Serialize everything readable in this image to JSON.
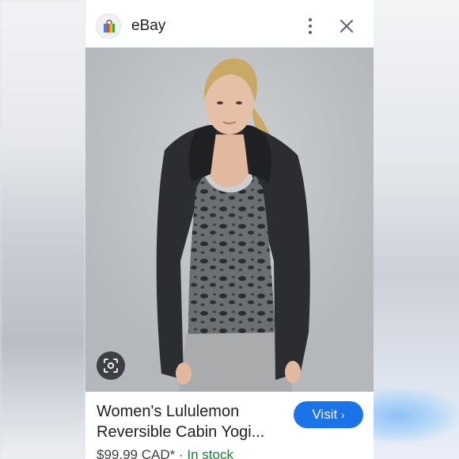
{
  "header": {
    "app_name": "eBay",
    "app_icon": "shopping-bag-icon",
    "more_icon": "more-vert-icon",
    "close_icon": "close-icon"
  },
  "image": {
    "alt": "Woman wearing dark cardigan over leopard print tank top",
    "lens_icon": "lens-search-icon"
  },
  "product": {
    "title_line1": "Women's Lululemon",
    "title_line2": "Reversible Cabin Yogi...",
    "visit_label": "Visit",
    "visit_icon": "chevron-right-icon",
    "price": "$99.99 CAD*",
    "separator": "·",
    "stock_status": "In stock"
  },
  "colors": {
    "accent": "#1a73e8",
    "in_stock": "#188038"
  }
}
